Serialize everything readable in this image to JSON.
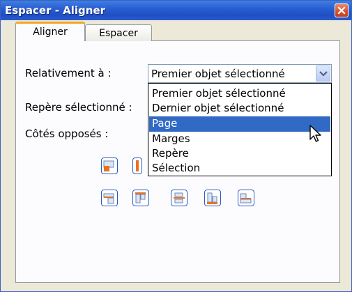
{
  "window": {
    "title": "Espacer - Aligner",
    "close_icon": "close-icon"
  },
  "tabs": [
    {
      "label": "Aligner",
      "active": true
    },
    {
      "label": "Espacer",
      "active": false
    }
  ],
  "fields": {
    "relative_label": "Relativement à :",
    "guide_label": "Repère sélectionné :",
    "opposite_label": "Côtés opposés :"
  },
  "combo": {
    "value": "Premier objet sélectionné",
    "options": [
      "Premier objet sélectionné",
      "Dernier objet sélectionné",
      "Page",
      "Marges",
      "Repère",
      "Sélection"
    ],
    "highlighted": "Page",
    "open": true
  },
  "align_buttons": {
    "row1": [
      "align-left-icon",
      "align-left-outside-icon"
    ],
    "row2": [
      "align-top-outside-icon",
      "align-top-icon",
      "center-horizontal-icon",
      "align-bottom-icon",
      "align-bottom-outside-icon"
    ]
  },
  "colors": {
    "title_bar": "#2a5ed3",
    "tab_accent": "#f5a623",
    "selection": "#316ac5",
    "icon_accent": "#e8731f"
  }
}
